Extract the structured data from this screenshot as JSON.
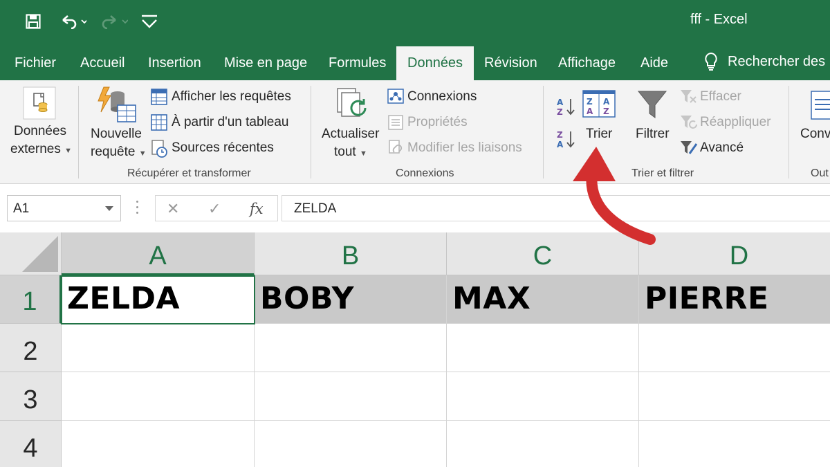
{
  "window": {
    "title": "fff  -  Excel",
    "accent": "#217346",
    "quick_access": {
      "save": "save-icon",
      "undo": "undo-icon",
      "redo": "redo-icon",
      "customize": "customize-qat-icon"
    }
  },
  "tabs": [
    {
      "label": "Fichier"
    },
    {
      "label": "Accueil"
    },
    {
      "label": "Insertion"
    },
    {
      "label": "Mise en page"
    },
    {
      "label": "Formules"
    },
    {
      "label": "Données",
      "active": true
    },
    {
      "label": "Révision"
    },
    {
      "label": "Affichage"
    },
    {
      "label": "Aide"
    }
  ],
  "search_tab": {
    "label": "Rechercher des",
    "icon": "lightbulb-icon"
  },
  "ribbon": {
    "external_data": {
      "line1": "Données",
      "line2": "externes"
    },
    "get_transform": {
      "new_query": {
        "line1": "Nouvelle",
        "line2": "requête"
      },
      "show_queries": "Afficher les requêtes",
      "from_table": "À partir d'un tableau",
      "recent_sources": "Sources récentes",
      "group_label": "Récupérer et transformer"
    },
    "connections": {
      "refresh_all": {
        "line1": "Actualiser",
        "line2": "tout"
      },
      "connections": "Connexions",
      "properties": "Propriétés",
      "edit_links": "Modifier les liaisons",
      "group_label": "Connexions"
    },
    "sort_filter": {
      "sort_az": "sort-a-to-z-icon",
      "sort_za": "sort-z-to-a-icon",
      "sort": "Trier",
      "filter": "Filtrer",
      "clear": "Effacer",
      "reapply": "Réappliquer",
      "advanced": "Avancé",
      "group_label": "Trier et filtrer"
    },
    "data_tools": {
      "convert": "Conv",
      "group_label": "Out"
    }
  },
  "formula_bar": {
    "name_box": "A1",
    "cancel": "✕",
    "enter": "✓",
    "fx": "fx",
    "content": "ZELDA"
  },
  "sheet": {
    "columns": [
      "A",
      "B",
      "C",
      "D"
    ],
    "rows": [
      "1",
      "2",
      "3",
      "4"
    ],
    "row1": [
      "ZELDA",
      "BOBY",
      "MAX",
      "PIERRE"
    ],
    "selected_cell": "A1"
  },
  "annotation": {
    "color": "#d32f2f",
    "points_to": "Trier"
  }
}
